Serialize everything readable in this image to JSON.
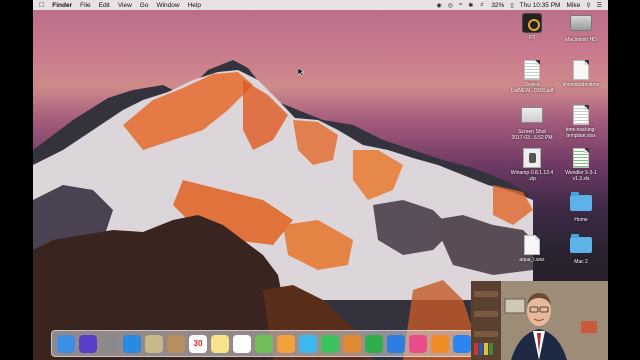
{
  "menubar": {
    "apple_icon": "apple-icon",
    "app_name": "Finder",
    "items": [
      "File",
      "Edit",
      "View",
      "Go",
      "Window",
      "Help"
    ],
    "battery": "32%",
    "clock": "Thu 10:35 PM",
    "user": "Mike"
  },
  "desktop": {
    "icons": [
      {
        "label": "P2",
        "kind": "app"
      },
      {
        "label": "Macintosh HD",
        "kind": "disk"
      },
      {
        "label": "Device\nListNEW...0316.pdf",
        "kind": "pdf"
      },
      {
        "label": "sheetstudentime",
        "kind": "doc"
      },
      {
        "label": "Screen Shot\n2017-03...6.52 PM",
        "kind": "screenshot"
      },
      {
        "label": "time-tracking-\ntemplate.xlsx",
        "kind": "spreadsheet"
      },
      {
        "label": "Winamp-0.8.1.13.4\n.zip",
        "kind": "zip"
      },
      {
        "label": "Wendler 5-3-1\nv1.3.xls",
        "kind": "spreadsheet"
      },
      {
        "label": "Home",
        "kind": "folder"
      },
      {
        "label": "aqua_t.wsz",
        "kind": "doc"
      },
      {
        "label": "Mac 2",
        "kind": "folder"
      }
    ]
  },
  "dock": {
    "items": [
      {
        "name": "finder-icon",
        "color": "#3d8ee6"
      },
      {
        "name": "siri-icon",
        "color": "#5a3ec8"
      },
      {
        "name": "launchpad-icon",
        "color": "#8a8a8a"
      },
      {
        "name": "safari-icon",
        "color": "#2a8ae0"
      },
      {
        "name": "mail-icon",
        "color": "#c9b98a"
      },
      {
        "name": "contacts-icon",
        "color": "#b89060"
      },
      {
        "name": "calendar-icon",
        "color": "#ffffff",
        "text": "30"
      },
      {
        "name": "notes-icon",
        "color": "#f7e38a"
      },
      {
        "name": "reminders-icon",
        "color": "#ffffff"
      },
      {
        "name": "maps-icon",
        "color": "#6fbf5a"
      },
      {
        "name": "photos-icon",
        "color": "#f2a23c"
      },
      {
        "name": "messages-icon",
        "color": "#3cb9f0"
      },
      {
        "name": "facetime-icon",
        "color": "#3cc25a"
      },
      {
        "name": "pages-icon",
        "color": "#e08a34"
      },
      {
        "name": "numbers-icon",
        "color": "#2fae4e"
      },
      {
        "name": "keynote-icon",
        "color": "#2e7de0"
      },
      {
        "name": "itunes-icon",
        "color": "#ea4c89"
      },
      {
        "name": "ibooks-icon",
        "color": "#f08a24"
      },
      {
        "name": "app-store-icon",
        "color": "#2d86f0"
      }
    ]
  }
}
